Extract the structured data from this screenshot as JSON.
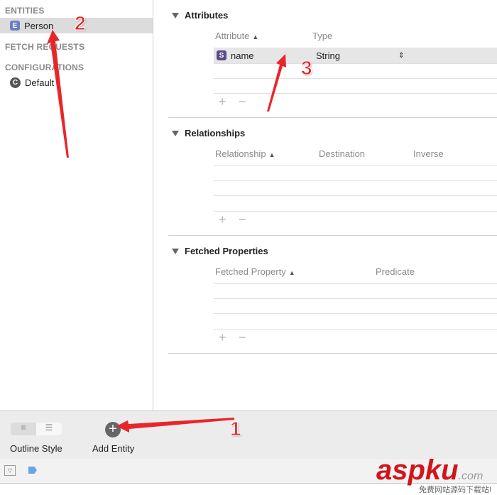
{
  "sidebar": {
    "entities_header": "ENTITIES",
    "entities": [
      {
        "badge": "E",
        "label": "Person"
      }
    ],
    "fetch_header": "FETCH REQUESTS",
    "config_header": "CONFIGURATIONS",
    "configurations": [
      {
        "badge": "C",
        "label": "Default"
      }
    ]
  },
  "attributes": {
    "title": "Attributes",
    "columns": [
      "Attribute",
      "Type"
    ],
    "rows": [
      {
        "badge": "S",
        "name": "name",
        "type": "String"
      }
    ]
  },
  "relationships": {
    "title": "Relationships",
    "columns": [
      "Relationship",
      "Destination",
      "Inverse"
    ]
  },
  "fetched": {
    "title": "Fetched Properties",
    "columns": [
      "Fetched Property",
      "Predicate"
    ]
  },
  "toolbar": {
    "outline_style": "Outline Style",
    "add_entity": "Add Entity"
  },
  "annotations": [
    "1",
    "2",
    "3"
  ],
  "watermark": {
    "brand": "aspku",
    "tld": ".com",
    "tagline": "免费网站源码下载站!"
  },
  "colors": {
    "arrow": "#e8262a",
    "entity_badge": "#6b7fc4",
    "selection": "#dcdcdc"
  }
}
